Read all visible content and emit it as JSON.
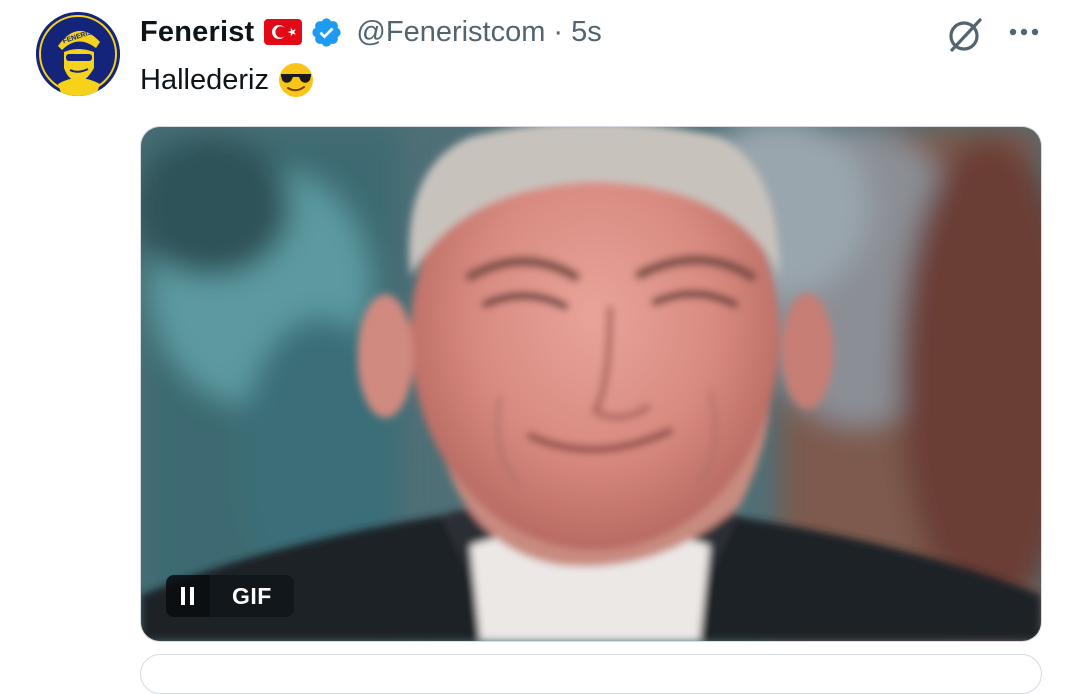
{
  "tweet": {
    "author": {
      "display_name": "Fenerist",
      "handle": "@Feneristcom",
      "verified": true,
      "flag_icon": "turkey-flag-icon",
      "verified_icon": "verified-badge-icon",
      "avatar_text": "FENERIST"
    },
    "separator": "·",
    "timestamp": "5s",
    "text": "Hallederiz",
    "text_emoji_icon": "sunglasses-face-emoji",
    "media": {
      "type": "gif",
      "badge_label": "GIF",
      "state": "playing",
      "control_icon": "pause-icon"
    },
    "actions": {
      "grok_icon": "grok-icon",
      "more_icon": "more-dots-icon"
    }
  },
  "colors": {
    "text_primary": "#0f1419",
    "text_secondary": "#536471",
    "verified_blue": "#1d9bf0",
    "flag_red": "#e30a17",
    "avatar_navy": "#13247a",
    "avatar_yellow": "#f6d21b"
  }
}
